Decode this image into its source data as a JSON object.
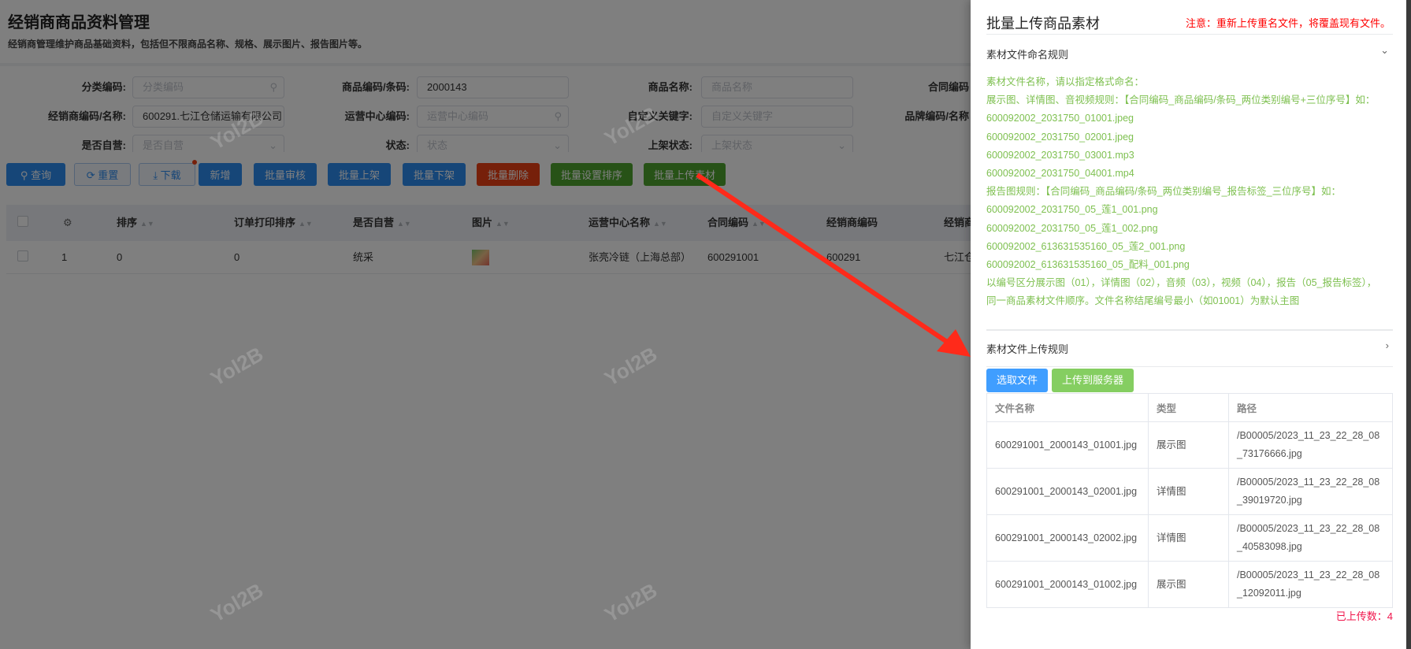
{
  "page": {
    "title": "经销商商品资料管理",
    "subtitle": "经销商管理维护商品基础资料，包括但不限商品名称、规格、展示图片、报告图片等。"
  },
  "filters": [
    {
      "label": "分类编码:",
      "value": "",
      "placeholder": "分类编码",
      "icon": "search-icon"
    },
    {
      "label": "商品编码/条码:",
      "value": "2000143",
      "placeholder": ""
    },
    {
      "label": "商品名称:",
      "value": "",
      "placeholder": "商品名称"
    },
    {
      "label": "合同编码",
      "value": "",
      "placeholder": ""
    },
    {
      "label": "经销商编码/名称:",
      "value": "600291.七江仓储运输有限公司",
      "placeholder": "",
      "icon": "search-icon"
    },
    {
      "label": "运营中心编码:",
      "value": "",
      "placeholder": "运营中心编码",
      "icon": "search-icon"
    },
    {
      "label": "自定义关键字:",
      "value": "",
      "placeholder": "自定义关键字"
    },
    {
      "label": "品牌编码/名称",
      "value": "",
      "placeholder": ""
    },
    {
      "label": "是否自营:",
      "value": "",
      "placeholder": "是否自营",
      "icon": "chevron-down-icon"
    },
    {
      "label": "状态:",
      "value": "",
      "placeholder": "状态",
      "icon": "chevron-down-icon"
    },
    {
      "label": "上架状态:",
      "value": "",
      "placeholder": "上架状态",
      "icon": "chevron-down-icon"
    }
  ],
  "toolbar": {
    "query": "查询",
    "reset": "重置",
    "download": "下载",
    "add": "新增",
    "batch_review": "批量审核",
    "batch_on": "批量上架",
    "batch_off": "批量下架",
    "batch_delete": "批量删除",
    "batch_sort": "批量设置排序",
    "batch_upload": "批量上传素材"
  },
  "table": {
    "headers": [
      "排序",
      "订单打印排序",
      "是否自营",
      "图片",
      "运营中心名称",
      "合同编码",
      "经销商编码",
      "经销商"
    ],
    "rows": [
      {
        "index": "1",
        "sort": "0",
        "print_sort": "0",
        "self_run": "统采",
        "center": "张亮冷链（上海总部）",
        "contract": "600291001",
        "dealer_code": "600291",
        "dealer_name": "七江仓"
      }
    ]
  },
  "watermark": "Yol2B",
  "drawer": {
    "title": "批量上传商品素材",
    "notice": "注意：重新上传重名文件，将覆盖现有文件。",
    "naming_title": "素材文件命名规则",
    "rules": [
      "素材文件名称，请以指定格式命名：",
      "展示图、详情图、音视频规则：【合同编码_商品编码/条码_两位类别编号+三位序号】如：",
      "600092002_2031750_01001.jpeg",
      "600092002_2031750_02001.jpeg",
      "600092002_2031750_03001.mp3",
      "600092002_2031750_04001.mp4",
      "报告图规则：【合同编码_商品编码/条码_两位类别编号_报告标签_三位序号】如：",
      "600092002_2031750_05_莲1_001.png",
      "600092002_2031750_05_莲1_002.png",
      "600092002_613631535160_05_莲2_001.png",
      "600092002_613631535160_05_配料_001.png",
      "以编号区分展示图（01），详情图（02），音频（03），视频（04），报告（05_报告标签），",
      "同一商品素材文件顺序。文件名称结尾编号最小（如01001）为默认主图"
    ],
    "upload_title": "素材文件上传规则",
    "select_btn": "选取文件",
    "upload_btn": "上传到服务器",
    "file_headers": [
      "文件名称",
      "类型",
      "路径"
    ],
    "files": [
      {
        "name": "600291001_2000143_01001.jpg",
        "type": "展示图",
        "path": "/B00005/2023_11_23_22_28_08_73176666.jpg"
      },
      {
        "name": "600291001_2000143_02001.jpg",
        "type": "详情图",
        "path": "/B00005/2023_11_23_22_28_08_39019720.jpg"
      },
      {
        "name": "600291001_2000143_02002.jpg",
        "type": "详情图",
        "path": "/B00005/2023_11_23_22_28_08_40583098.jpg"
      },
      {
        "name": "600291001_2000143_01002.jpg",
        "type": "展示图",
        "path": "/B00005/2023_11_23_22_28_08_12092011.jpg"
      }
    ],
    "uploaded_count": "已上传数：4"
  },
  "colors": {
    "primary": "#2d8cf0",
    "danger": "#ed4014",
    "success": "#4fa52e",
    "rule_text": "#7ec050",
    "notice": "#ff0000",
    "annotation_arrow": "#ff2a1a"
  }
}
